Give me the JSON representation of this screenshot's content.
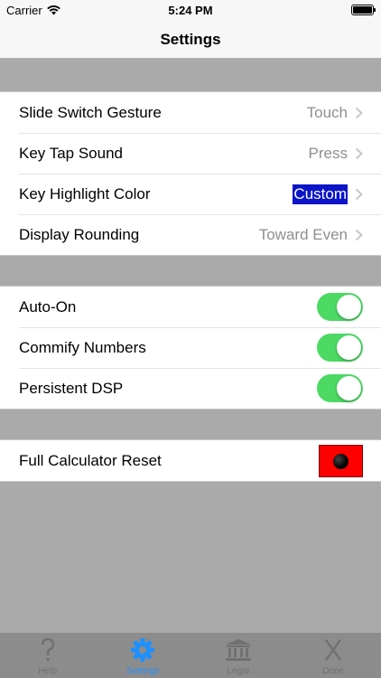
{
  "status_bar": {
    "carrier": "Carrier",
    "time": "5:24 PM"
  },
  "nav": {
    "title": "Settings"
  },
  "preferences": [
    {
      "label": "Slide Switch Gesture",
      "value": "Touch"
    },
    {
      "label": "Key Tap Sound",
      "value": "Press"
    },
    {
      "label": "Key Highlight Color",
      "value": "Custom"
    },
    {
      "label": "Display Rounding",
      "value": "Toward Even"
    }
  ],
  "toggles": [
    {
      "label": "Auto-On",
      "on": true
    },
    {
      "label": "Commify Numbers",
      "on": true
    },
    {
      "label": "Persistent DSP",
      "on": true
    }
  ],
  "reset": {
    "label": "Full Calculator Reset"
  },
  "tabs": [
    {
      "label": "Help",
      "icon": "question-mark-icon"
    },
    {
      "label": "Settings",
      "icon": "gear-icon",
      "active": true
    },
    {
      "label": "Legal",
      "icon": "bank-building-icon"
    },
    {
      "label": "Done",
      "icon": "x-close-icon"
    }
  ],
  "colors": {
    "toggle_on": "#4cd964",
    "highlight": "#0a14c8",
    "reset": "#ff0000",
    "active_tab": "#1e90ff"
  }
}
